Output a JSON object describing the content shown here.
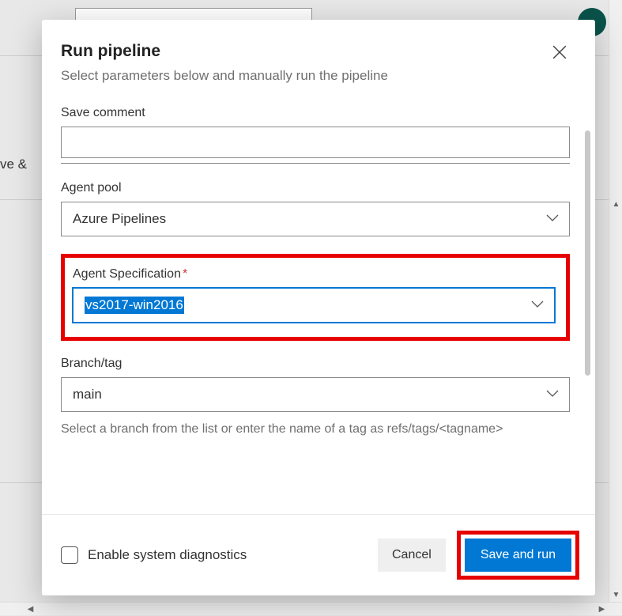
{
  "background": {
    "left_text_fragment": "ve &"
  },
  "modal": {
    "title": "Run pipeline",
    "subtitle": "Select parameters below and manually run the pipeline",
    "fields": {
      "save_comment": {
        "label": "Save comment",
        "value": ""
      },
      "agent_pool": {
        "label": "Agent pool",
        "value": "Azure Pipelines"
      },
      "agent_spec": {
        "label": "Agent Specification",
        "required": true,
        "value": "vs2017-win2016"
      },
      "branch": {
        "label": "Branch/tag",
        "value": "main",
        "helper": "Select a branch from the list or enter the name of a tag as refs/tags/<tagname>"
      }
    },
    "footer": {
      "diagnostics_label": "Enable system diagnostics",
      "cancel_label": "Cancel",
      "primary_label": "Save and run"
    }
  }
}
